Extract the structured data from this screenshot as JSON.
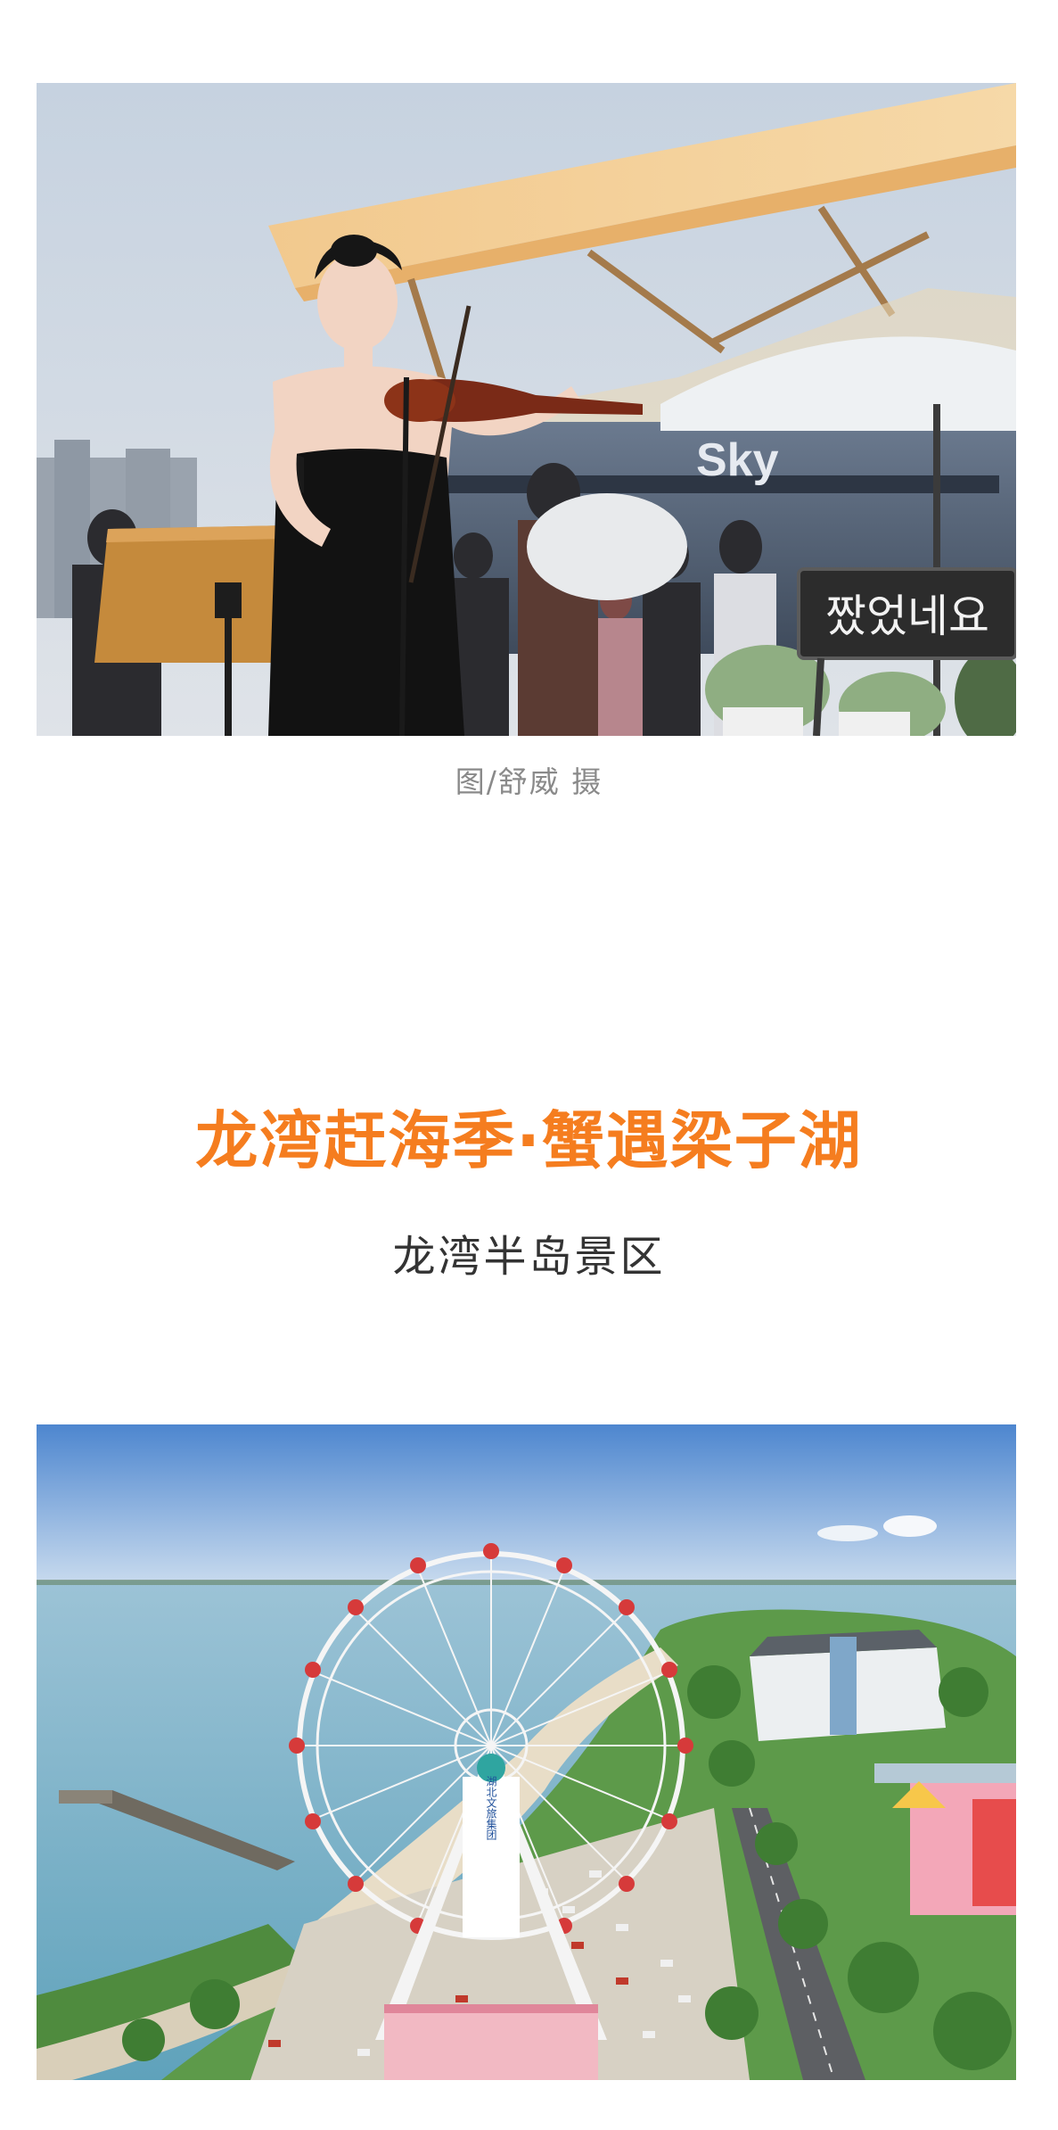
{
  "photo1": {
    "sign_text": "짰었네요",
    "building_text": "Sky"
  },
  "caption": "图/舒威 摄",
  "headline": "龙湾赶海季·蟹遇梁子湖",
  "subhead": "龙湾半岛景区",
  "photo2": {
    "tower_text": "湖北文旅集团"
  }
}
